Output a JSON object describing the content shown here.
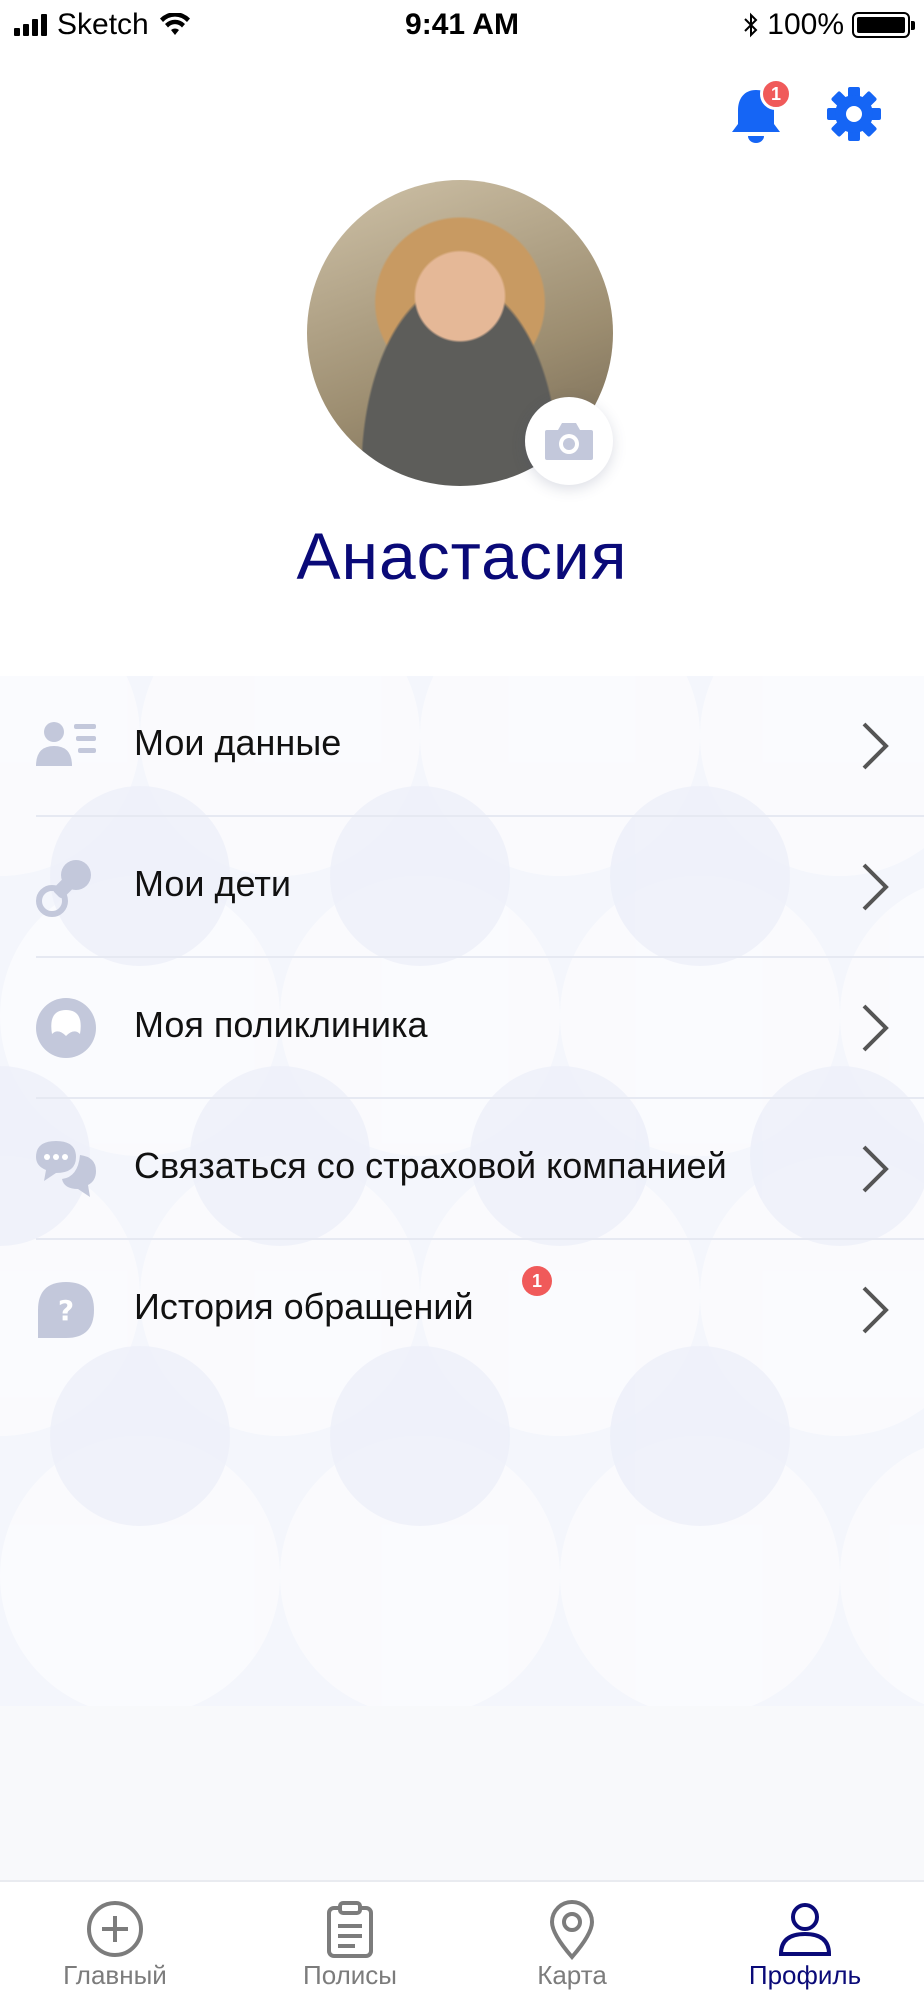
{
  "status_bar": {
    "carrier": "Sketch",
    "time": "9:41 AM",
    "battery": "100%"
  },
  "header": {
    "notification_count": "1"
  },
  "profile": {
    "name": "Анастасия"
  },
  "menu": {
    "items": [
      {
        "label": "Мои данные",
        "icon": "user-list-icon"
      },
      {
        "label": "Мои дети",
        "icon": "pacifier-icon"
      },
      {
        "label": "Моя поликлиника",
        "icon": "clinic-icon"
      },
      {
        "label": "Связаться со страховой компанией",
        "icon": "chat-bubbles-icon"
      },
      {
        "label": "История обращений",
        "icon": "question-bubble-icon",
        "badge": "1"
      }
    ]
  },
  "tab_bar": {
    "tabs": [
      {
        "label": "Главный",
        "icon": "plus-circle-icon",
        "active": false
      },
      {
        "label": "Полисы",
        "icon": "clipboard-icon",
        "active": false
      },
      {
        "label": "Карта",
        "icon": "map-pin-icon",
        "active": false
      },
      {
        "label": "Профиль",
        "icon": "person-icon",
        "active": true
      }
    ]
  },
  "colors": {
    "accent_blue": "#1565f5",
    "title_navy": "#0a0a78",
    "badge_red": "#f05a5a",
    "icon_gray": "#c3c8db",
    "content_bg": "#f4f6fc"
  }
}
